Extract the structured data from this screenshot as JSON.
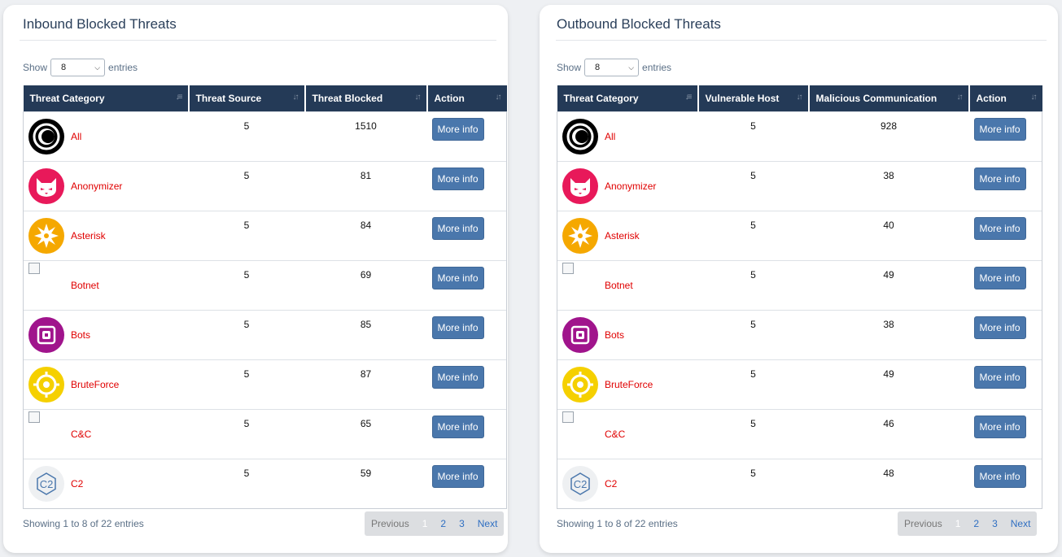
{
  "inbound": {
    "title": "Inbound Blocked Threats",
    "length": {
      "show": "Show",
      "value": "8",
      "entries": "entries"
    },
    "headers": [
      "Threat Category",
      "Threat Source",
      "Threat Blocked",
      "Action"
    ],
    "rows": [
      {
        "category": "All",
        "icon": "all-icon",
        "a": "5",
        "b": "1510",
        "action": "More info"
      },
      {
        "category": "Anonymizer",
        "icon": "anonymizer-cat-icon",
        "a": "5",
        "b": "81",
        "action": "More info"
      },
      {
        "category": "Asterisk",
        "icon": "asterisk-icon",
        "a": "5",
        "b": "84",
        "action": "More info"
      },
      {
        "category": "Botnet",
        "icon": "broken-image-icon",
        "a": "5",
        "b": "69",
        "action": "More info"
      },
      {
        "category": "Bots",
        "icon": "bots-icon",
        "a": "5",
        "b": "85",
        "action": "More info"
      },
      {
        "category": "BruteForce",
        "icon": "bruteforce-target-icon",
        "a": "5",
        "b": "87",
        "action": "More info"
      },
      {
        "category": "C&C",
        "icon": "broken-image-icon",
        "a": "5",
        "b": "65",
        "action": "More info"
      },
      {
        "category": "C2",
        "icon": "c2-hexagon-icon",
        "a": "5",
        "b": "59",
        "action": "More info"
      }
    ],
    "info": "Showing 1 to 8 of 22 entries",
    "pager": {
      "prev": "Previous",
      "pages": [
        "1",
        "2",
        "3"
      ],
      "next": "Next"
    }
  },
  "outbound": {
    "title": "Outbound Blocked Threats",
    "length": {
      "show": "Show",
      "value": "8",
      "entries": "entries"
    },
    "headers": [
      "Threat Category",
      "Vulnerable Host",
      "Malicious Communication",
      "Action"
    ],
    "rows": [
      {
        "category": "All",
        "icon": "all-icon",
        "a": "5",
        "b": "928",
        "action": "More info"
      },
      {
        "category": "Anonymizer",
        "icon": "anonymizer-cat-icon",
        "a": "5",
        "b": "38",
        "action": "More info"
      },
      {
        "category": "Asterisk",
        "icon": "asterisk-icon",
        "a": "5",
        "b": "40",
        "action": "More info"
      },
      {
        "category": "Botnet",
        "icon": "broken-image-icon",
        "a": "5",
        "b": "49",
        "action": "More info"
      },
      {
        "category": "Bots",
        "icon": "bots-icon",
        "a": "5",
        "b": "38",
        "action": "More info"
      },
      {
        "category": "BruteForce",
        "icon": "bruteforce-target-icon",
        "a": "5",
        "b": "49",
        "action": "More info"
      },
      {
        "category": "C&C",
        "icon": "broken-image-icon",
        "a": "5",
        "b": "46",
        "action": "More info"
      },
      {
        "category": "C2",
        "icon": "c2-hexagon-icon",
        "a": "5",
        "b": "48",
        "action": "More info"
      }
    ],
    "info": "Showing 1 to 8 of 22 entries",
    "pager": {
      "prev": "Previous",
      "pages": [
        "1",
        "2",
        "3"
      ],
      "next": "Next"
    }
  },
  "colors": {
    "header": "#243a57",
    "button": "#4a77ac",
    "category_text": "#e00000"
  }
}
